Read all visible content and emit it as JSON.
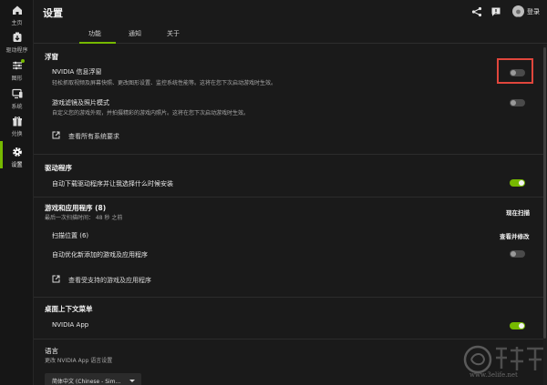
{
  "sidebar": {
    "items": [
      {
        "label": "主页",
        "icon": "home-icon"
      },
      {
        "label": "驱动程序",
        "icon": "driver-icon"
      },
      {
        "label": "图形",
        "icon": "graphics-sliders-icon"
      },
      {
        "label": "系统",
        "icon": "system-monitor-icon"
      },
      {
        "label": "兑换",
        "icon": "redeem-gift-icon"
      },
      {
        "label": "设置",
        "icon": "gear-icon"
      }
    ],
    "active_index": 5,
    "accent": "#76b900"
  },
  "header": {
    "title": "设置",
    "login_label": "登录",
    "icons": [
      "share-icon",
      "feedback-icon",
      "avatar"
    ]
  },
  "tabs": [
    {
      "label": "功能",
      "active": true
    },
    {
      "label": "通知",
      "active": false
    },
    {
      "label": "关于",
      "active": false
    }
  ],
  "overlay": {
    "title": "浮窗",
    "nvidia_overlay": {
      "title": "NVIDIA 信息浮窗",
      "desc": "轻松抓取视频及屏幕快照、更改图形设置、监控系统性能等。这将在您下次启动游戏时生效。",
      "enabled": false
    },
    "game_filters": {
      "title": "游戏滤镜及照片模式",
      "desc": "自定义您的游戏外观，并拍摄精彩的游戏内照片。这将在您下次启动游戏时生效。",
      "enabled": false
    },
    "requirements_link": "查看所有系统要求"
  },
  "driver": {
    "title": "驱动程序",
    "auto_download": {
      "title": "自动下载驱动程序并让我选择什么时候安装",
      "enabled": true
    }
  },
  "games": {
    "title": "游戏和应用程序 (8)",
    "last_scan": "最后一次扫描时间： 48 秒 之前",
    "scan_now": "现在扫描",
    "scan_locations": "扫描位置 (6)",
    "view_and_edit": "查看并修改",
    "auto_optimize": {
      "title": "自动优化新添加的游戏及应用程序",
      "enabled": false
    },
    "supported_link": "查看受支持的游戏及应用程序"
  },
  "context_menu": {
    "title": "桌面上下文菜单",
    "nvidia_app": {
      "title": "NVIDIA App",
      "enabled": true
    }
  },
  "language": {
    "title": "语言",
    "desc": "更改 NVIDIA App 语言设置",
    "selected": "简体中文 (Chinese - Sim..."
  },
  "watermark": {
    "url": "www.3elife.net"
  },
  "colors": {
    "accent": "#76b900",
    "highlight": "#e0463c",
    "background": "#1a1a1a"
  }
}
